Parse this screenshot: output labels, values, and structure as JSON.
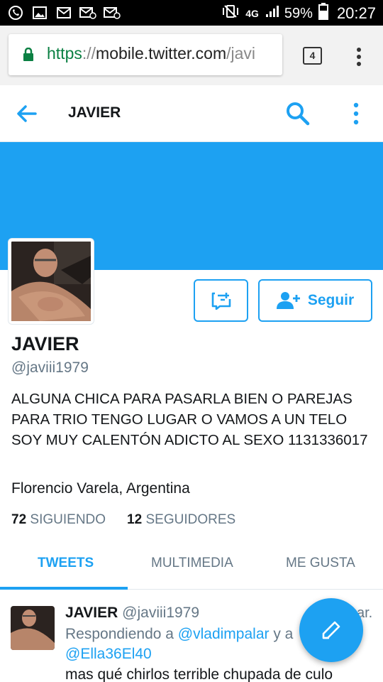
{
  "status_bar": {
    "network": "4G",
    "battery": "59%",
    "time": "20:27"
  },
  "browser": {
    "url_scheme": "https",
    "url_sep": "://",
    "url_host": "mobile.twitter.com",
    "url_path": "/javi",
    "tab_count": "4"
  },
  "header": {
    "title": "JAVIER"
  },
  "profile": {
    "name": "JAVIER",
    "handle": "@javiii1979",
    "bio": "ALGUNA CHICA PARA PASARLA BIEN O PAREJAS PARA TRIO TENGO LUGAR O VAMOS A UN TELO SOY MUY CALENTÓN ADICTO AL SEXO 1131336017",
    "location": "Florencio Varela, Argentina",
    "following_count": "72",
    "following_label": "SIGUIENDO",
    "followers_count": "12",
    "followers_label": "SEGUIDORES",
    "follow_label": "Seguir"
  },
  "tabs": [
    {
      "label": "TWEETS",
      "active": true
    },
    {
      "label": "MULTIMEDIA",
      "active": false
    },
    {
      "label": "ME GUSTA",
      "active": false
    }
  ],
  "tweet": {
    "name": "JAVIER",
    "handle": "@javiii1979",
    "time": "ar.",
    "replying_prefix": "Respondiendo a ",
    "mention1": "@vladimpalar",
    "replying_join": " y a",
    "mention2": "@Ella36El40",
    "text": "mas qué chirlos terrible chupada de culo"
  },
  "colors": {
    "accent": "#1da1f2",
    "secure": "#0b8043"
  }
}
